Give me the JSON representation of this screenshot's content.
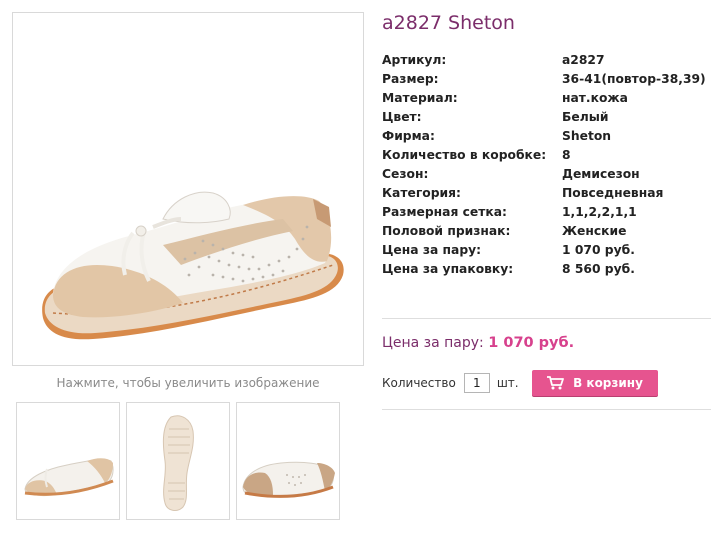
{
  "product": {
    "title": "a2827 Sheton",
    "zoom_hint": "Нажмите, чтобы увеличить изображение"
  },
  "images": {
    "main": "shoe-side-view",
    "thumbnails": [
      "shoe-side-view",
      "shoe-sole",
      "shoe-inner-side"
    ]
  },
  "specs": [
    {
      "label": "Артикул:",
      "value": "a2827"
    },
    {
      "label": "Размер:",
      "value": "36-41(повтор-38,39)"
    },
    {
      "label": "Материал:",
      "value": "нат.кожа"
    },
    {
      "label": "Цвет:",
      "value": "Белый"
    },
    {
      "label": "Фирма:",
      "value": "Sheton"
    },
    {
      "label": "Количество в коробке:",
      "value": "8"
    },
    {
      "label": "Сезон:",
      "value": "Демисезон"
    },
    {
      "label": "Категория:",
      "value": "Повседневная"
    },
    {
      "label": "Размерная сетка:",
      "value": "1,1,2,2,1,1"
    },
    {
      "label": "Половой признак:",
      "value": "Женские"
    },
    {
      "label": "Цена за пару:",
      "value": "1 070 руб."
    },
    {
      "label": "Цена за упаковку:",
      "value": "8 560 руб."
    }
  ],
  "price": {
    "label": "Цена за пару:",
    "value": "1 070 руб."
  },
  "order": {
    "qty_label": "Количество",
    "qty_value": "1",
    "unit": "шт.",
    "cart_button": "В корзину"
  },
  "colors": {
    "title": "#7b2d6a",
    "accent": "#e6548f",
    "price": "#d7418d"
  }
}
